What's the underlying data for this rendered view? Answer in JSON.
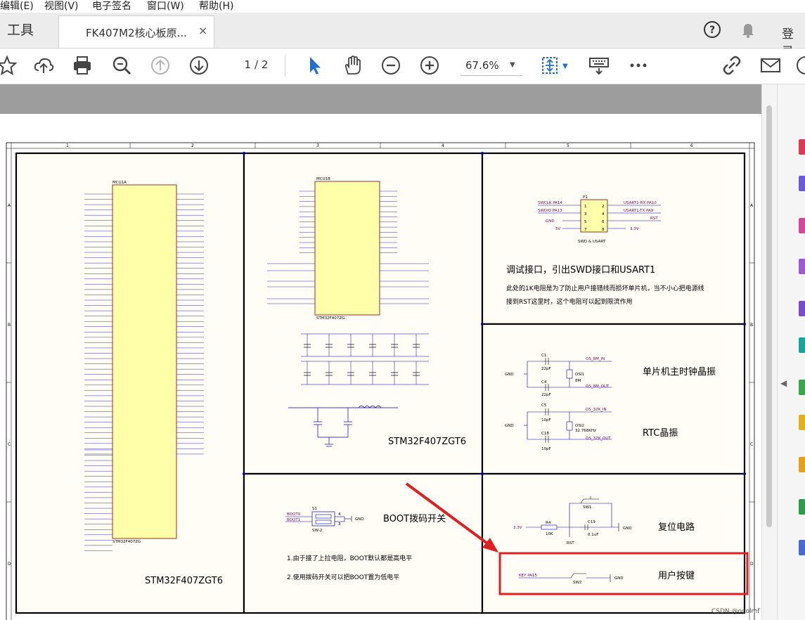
{
  "menu": [
    "编辑(E)",
    "视图(V)",
    "电子签名",
    "窗口(W)",
    "帮助(H)"
  ],
  "tabs": {
    "tools": "工具",
    "document": "FK407M2核心板原...",
    "close": "×"
  },
  "header_right": {
    "login": "登录"
  },
  "toolbar": {
    "page_current": "1",
    "page_total": "/ 2",
    "zoom": "67.6%"
  },
  "schematic": {
    "col_labels": [
      "1",
      "2",
      "3",
      "4",
      "5",
      "6"
    ],
    "row_labels": [
      "A",
      "B",
      "C",
      "D"
    ],
    "mcu_title": "STM32F407ZGT6",
    "mcu_center_title": "STM32F407ZGT6",
    "mcu1a": "MCU1A",
    "mcu1b": "MCU1B",
    "mcu_part": "STM32F407ZG",
    "swd_title": "调试接口，引出SWD接口和USART1",
    "swd_note1": "此处的1K电阻是为了防止用户接错线而损坏单片机，当不小心把电源线",
    "swd_note2": "接到RST这里时，这个电阻可以起到限流作用",
    "swd_label": "SWD & USART",
    "xtal_title": "单片机主时钟晶振",
    "rtc_title": "RTC晶振",
    "boot_title": "BOOT拨码开关",
    "boot_note1": "1.由于接了上拉电阻，BOOT默认都是高电平",
    "boot_note2": "2.使用拨码开关可以把BOOT置为低电平",
    "reset_title": "复位电路",
    "key_title": "用户按键",
    "key_net": "KEY PA15",
    "watermark": "CSDN @ooolmf"
  },
  "colors": {
    "accent_red": "#e02020",
    "chip_fill": "#ffffaa",
    "wire": "#0000aa",
    "net": "#7a0060",
    "border": "#000000"
  }
}
